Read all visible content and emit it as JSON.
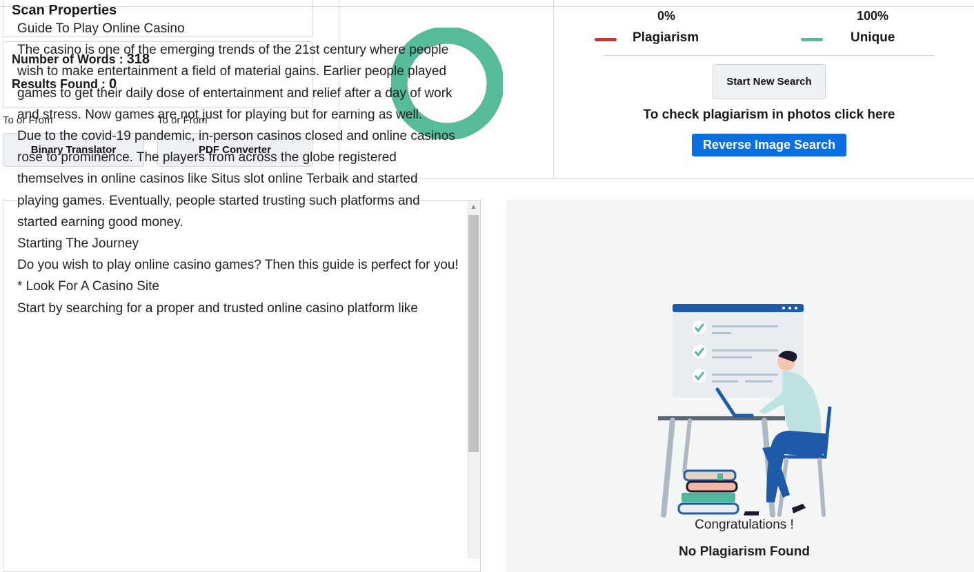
{
  "scan": {
    "title": "Scan Properties",
    "words_label": "Number of Words : ",
    "words_value": "318",
    "results_label": "Results Found : ",
    "results_value": "0"
  },
  "tools": [
    {
      "caption": "To or From",
      "label": "Binary Translator"
    },
    {
      "caption": "To or From",
      "label": "PDF Converter"
    }
  ],
  "result": {
    "plagiarism_pct": "0%",
    "unique_pct": "100%",
    "plagiarism_label": "Plagiarism",
    "unique_label": "Unique",
    "unique_fraction": 1.0,
    "plagiarism_color": "#d9302c",
    "unique_color": "#56bb9b",
    "new_search_label": "Start New Search",
    "photo_text": "To check plagiarism in photos click here",
    "reverse_label": "Reverse Image Search"
  },
  "content": {
    "lines": [
      "Guide To Play Online Casino",
      "The casino is one of the emerging trends of the 21st century where people wish to make entertainment a field of material gains. Earlier people played games to get their daily dose of entertainment and relief after a day of work and stress. Now games are not just for playing but for earning as well.",
      "Due to the covid-19 pandemic, in-person casinos closed and online casinos rose to prominence. The players from across the globe registered themselves in online casinos like Situs slot online Terbaik and started playing games. Eventually, people started trusting such platforms and started earning good money.",
      "Starting The Journey",
      "Do you wish to play online casino games? Then this guide is perfect for you!",
      "* Look For A Casino Site",
      "Start by searching for a proper and trusted online casino platform like"
    ]
  },
  "outcome": {
    "congrats": "Congratulations !",
    "no_plagiarism": "No Plagiarism Found"
  }
}
